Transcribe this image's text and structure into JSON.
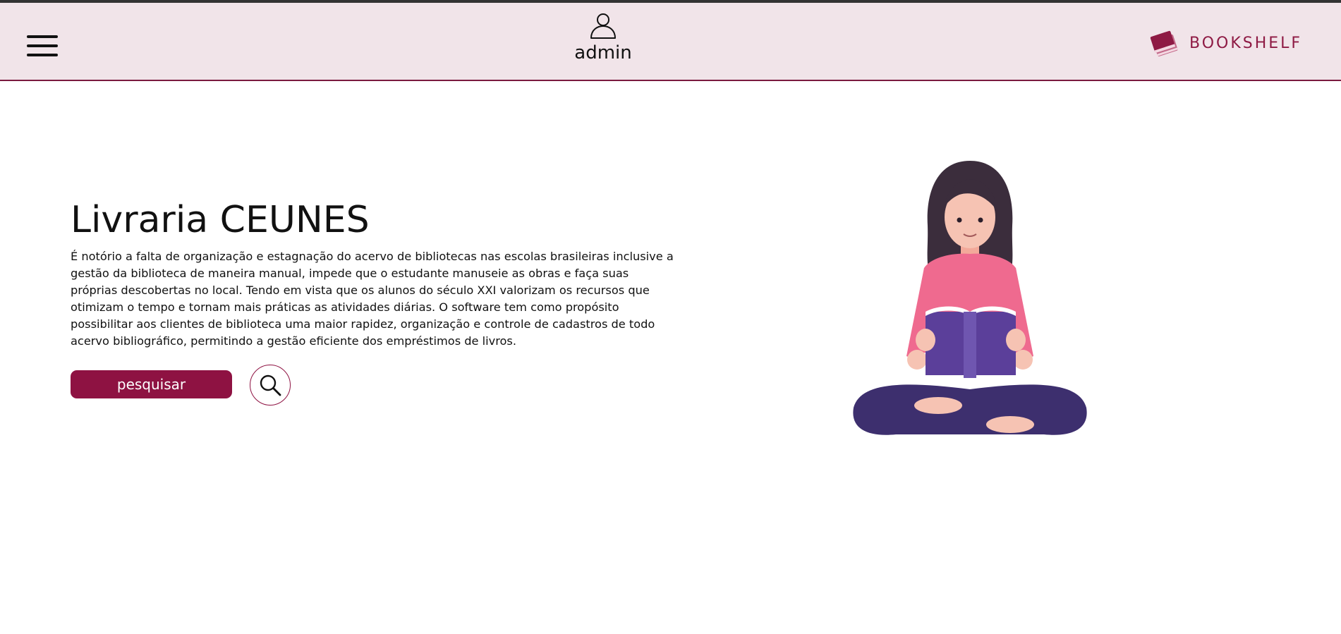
{
  "header": {
    "user_name": "admin",
    "logo_text": "BOOKSHELF"
  },
  "hero": {
    "title": "Livraria CEUNES",
    "description": "É notório a falta de organização e estagnação do acervo de bibliotecas nas escolas brasileiras inclusive a gestão da biblioteca de maneira manual, impede que o estudante manuseie as obras e faça suas próprias descobertas no local. Tendo em vista que os alunos do século XXI valorizam os recursos que otimizam o tempo e tornam mais práticas as atividades diárias. O software tem como propósito possibilitar aos clientes de biblioteca uma maior rapidez, organização e controle de cadastros de todo acervo bibliográfico, permitindo a gestão eficiente dos empréstimos de livros.",
    "search_button_label": "pesquisar"
  },
  "icons": {
    "menu": "hamburger-menu-icon",
    "user": "user-icon",
    "logo": "books-logo-icon",
    "search": "magnifier-icon",
    "illustration": "woman-reading-book-illustration"
  },
  "colors": {
    "header_bg": "#f1e4e9",
    "accent": "#8e1242",
    "header_border": "#7a1a3f"
  }
}
